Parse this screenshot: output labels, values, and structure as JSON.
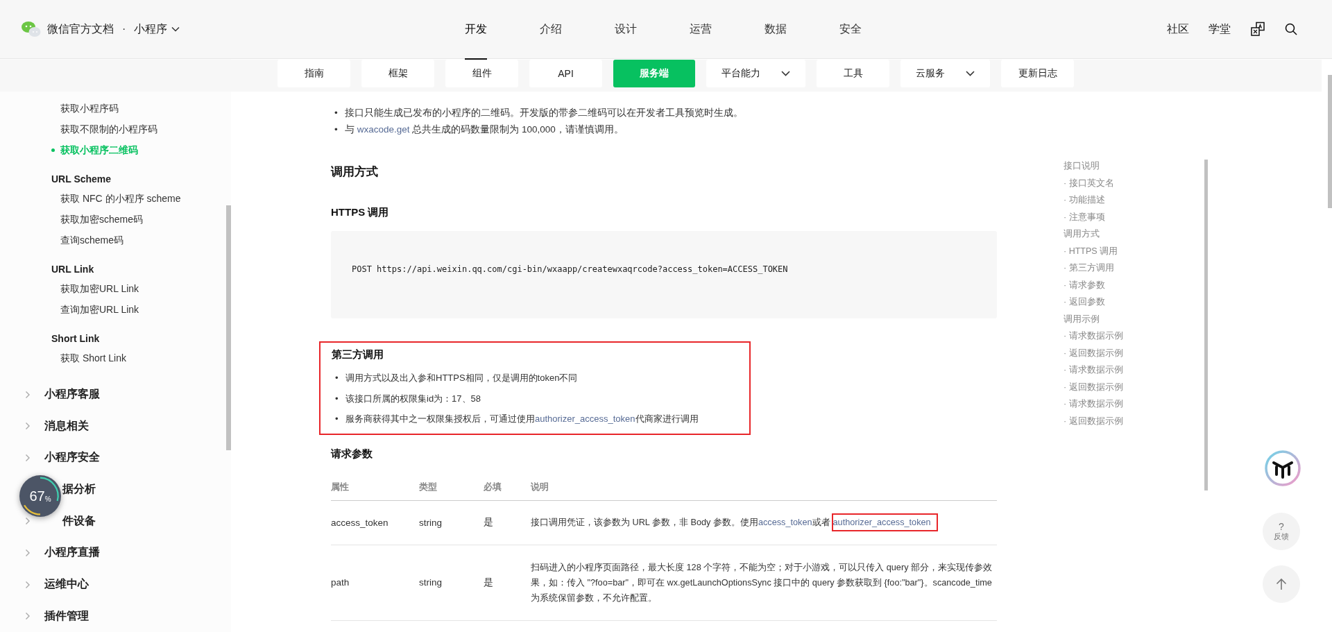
{
  "header": {
    "brand": "微信官方文档",
    "separator": "·",
    "product": "小程序",
    "nav": [
      {
        "label": "开发",
        "selected": true
      },
      {
        "label": "介绍",
        "selected": false
      },
      {
        "label": "设计",
        "selected": false
      },
      {
        "label": "运营",
        "selected": false
      },
      {
        "label": "数据",
        "selected": false
      },
      {
        "label": "安全",
        "selected": false
      }
    ],
    "links": [
      "社区",
      "学堂"
    ]
  },
  "subnav": [
    {
      "label": "指南",
      "selected": false,
      "has_menu": false
    },
    {
      "label": "框架",
      "selected": false,
      "has_menu": false
    },
    {
      "label": "组件",
      "selected": false,
      "has_menu": false
    },
    {
      "label": "API",
      "selected": false,
      "has_menu": false
    },
    {
      "label": "服务端",
      "selected": true,
      "has_menu": false
    },
    {
      "label": "平台能力",
      "selected": false,
      "has_menu": true
    },
    {
      "label": "工具",
      "selected": false,
      "has_menu": false
    },
    {
      "label": "云服务",
      "selected": false,
      "has_menu": true
    },
    {
      "label": "更新日志",
      "selected": false,
      "has_menu": false
    }
  ],
  "sidebar": {
    "items": [
      {
        "kind": "link",
        "label": "获取小程序码",
        "selected": false
      },
      {
        "kind": "link",
        "label": "获取不限制的小程序码",
        "selected": false
      },
      {
        "kind": "link",
        "label": "获取小程序二维码",
        "selected": true
      },
      {
        "kind": "group",
        "label": "URL Scheme"
      },
      {
        "kind": "link",
        "label": "获取 NFC 的小程序 scheme",
        "selected": false
      },
      {
        "kind": "link",
        "label": "获取加密scheme码",
        "selected": false
      },
      {
        "kind": "link",
        "label": "查询scheme码",
        "selected": false
      },
      {
        "kind": "group",
        "label": "URL Link"
      },
      {
        "kind": "link",
        "label": "获取加密URL Link",
        "selected": false
      },
      {
        "kind": "link",
        "label": "查询加密URL Link",
        "selected": false
      },
      {
        "kind": "group",
        "label": "Short Link"
      },
      {
        "kind": "link",
        "label": "获取 Short Link",
        "selected": false
      },
      {
        "kind": "section",
        "label": "小程序客服",
        "expanded": false
      },
      {
        "kind": "section",
        "label": "消息相关",
        "expanded": false
      },
      {
        "kind": "section",
        "label": "小程序安全",
        "expanded": false
      },
      {
        "kind": "section",
        "label": "据分析",
        "obscured": true
      },
      {
        "kind": "section",
        "label": "件设备",
        "expanded": false,
        "obscured": true
      },
      {
        "kind": "section",
        "label": "小程序直播",
        "expanded": false
      },
      {
        "kind": "section",
        "label": "运维中心",
        "expanded": false
      },
      {
        "kind": "section",
        "label": "插件管理",
        "expanded": false
      }
    ]
  },
  "progress_widget": {
    "reading": "67",
    "unit": "%"
  },
  "content": {
    "notes": [
      {
        "marker": "•",
        "segments": [
          {
            "text": "接口只能生成已发布的小程序的二维码。开发版的带参二维码可以在开发者工具预览时生成。"
          }
        ]
      },
      {
        "marker": "•",
        "segments": [
          {
            "text": "与 "
          },
          {
            "text": "wxacode.get",
            "link": true
          },
          {
            "text": " 总共生成的码数量限制为 100,000，请谨慎调用。"
          }
        ]
      }
    ],
    "call_title": "调用方式",
    "https_title": "HTTPS 调用",
    "code": "POST https://api.weixin.qq.com/cgi-bin/wxaapp/createwxaqrcode?access_token=ACCESS_TOKEN",
    "third_party": {
      "title": "第三方调用",
      "highlighted": true,
      "bullets": [
        {
          "marker": "•",
          "segments": [
            {
              "text": "调用方式以及出入参和HTTPS相同，仅是调用的token不同"
            }
          ]
        },
        {
          "marker": "•",
          "segments": [
            {
              "text": "该接口所属的权限集id为：17、58"
            }
          ]
        },
        {
          "marker": "•",
          "segments": [
            {
              "text": "服务商获得其中之一权限集授权后，可通过使用"
            },
            {
              "text": "authorizer_access_token",
              "link": true
            },
            {
              "text": "代商家进行调用"
            }
          ]
        }
      ]
    },
    "params_title": "请求参数",
    "table": {
      "columns": [
        "属性",
        "类型",
        "必填",
        "说明"
      ],
      "rows": [
        {
          "cells": [
            "access_token",
            "string",
            "是"
          ],
          "description": [
            {
              "text": "接口调用凭证，该参数为 URL 参数，非 Body 参数。使用"
            },
            {
              "text": "access_token",
              "link": true
            },
            {
              "text": "或者"
            },
            {
              "text": "authorizer_access_token",
              "link": true,
              "boxed": true
            }
          ]
        },
        {
          "cells": [
            "path",
            "string",
            "是"
          ],
          "description": [
            {
              "text": "扫码进入的小程序页面路径，最大长度 128 个字符，不能为空；对于小游戏，可以只传入 query 部分，来实现传参效果，如：传入 \"?foo=bar\"，即可在 wx.getLaunchOptionsSync 接口中的 query 参数获取到 {foo:\"bar\"}。scancode_time为系统保留参数，不允许配置。"
            }
          ]
        }
      ]
    }
  },
  "toc": [
    {
      "label": "接口说明",
      "children": [
        {
          "label": "· 接口英文名"
        },
        {
          "label": "· 功能描述"
        },
        {
          "label": "· 注意事项"
        }
      ]
    },
    {
      "label": "调用方式",
      "children": [
        {
          "label": "· HTTPS 调用"
        },
        {
          "label": "· 第三方调用"
        },
        {
          "label": "· 请求参数"
        },
        {
          "label": "· 返回参数"
        }
      ]
    },
    {
      "label": "调用示例",
      "children": [
        {
          "label": "· 请求数据示例"
        },
        {
          "label": "· 返回数据示例"
        },
        {
          "label": "· 请求数据示例"
        },
        {
          "label": "· 返回数据示例"
        },
        {
          "label": "· 请求数据示例"
        },
        {
          "label": "· 返回数据示例"
        }
      ]
    }
  ],
  "feedback": {
    "icon": "?",
    "label": "反馈"
  }
}
